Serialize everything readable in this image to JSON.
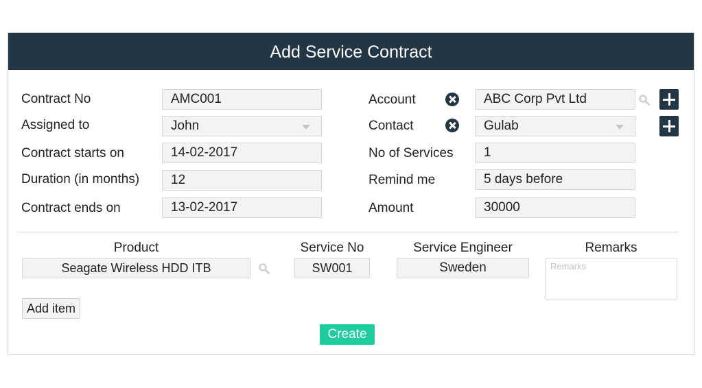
{
  "header": {
    "title": "Add Service Contract"
  },
  "left_fields": [
    {
      "label": "Contract No",
      "value": "AMC001"
    },
    {
      "label": "Assigned to",
      "value": "John"
    },
    {
      "label": "Contract starts on",
      "value": "14-02-2017"
    },
    {
      "label": "Duration (in months)",
      "value": "12"
    },
    {
      "label": "Contract ends on",
      "value": "13-02-2017"
    }
  ],
  "right_fields": [
    {
      "label": "Account",
      "value": "ABC Corp Pvt Ltd"
    },
    {
      "label": "Contact",
      "value": "Gulab"
    },
    {
      "label": "No of Services",
      "value": "1"
    },
    {
      "label": "Remind me",
      "value": "5 days before"
    },
    {
      "label": "Amount",
      "value": "30000"
    }
  ],
  "items": {
    "headers": {
      "product": "Product",
      "service_no": "Service No",
      "service_engineer": "Service Engineer",
      "remarks": "Remarks"
    },
    "row": {
      "product": "Seagate Wireless HDD ITB",
      "service_no": "SW001",
      "service_engineer": "Sweden",
      "remarks_placeholder": "Remarks"
    }
  },
  "buttons": {
    "add_item": "Add item",
    "create": "Create"
  }
}
